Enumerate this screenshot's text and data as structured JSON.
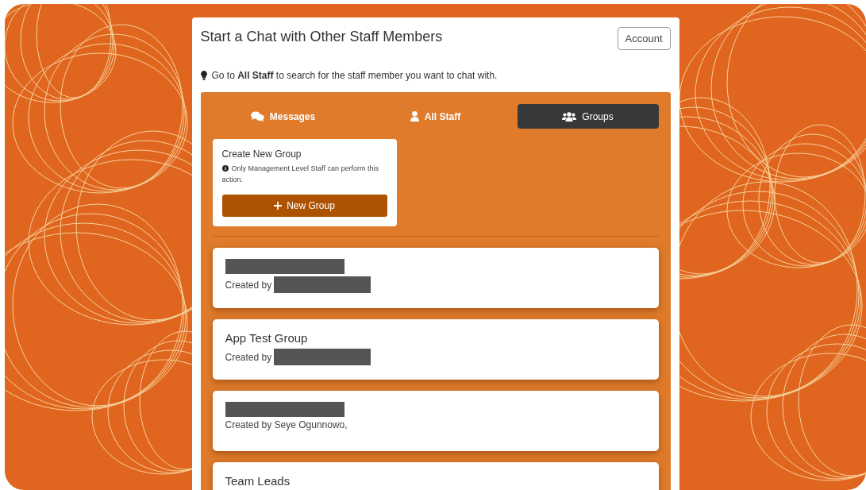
{
  "header": {
    "title": "Start a Chat with Other Staff Members",
    "account_button": "Account"
  },
  "hint": {
    "text": "Go to **All Staff** to search for the staff member you want to chat with."
  },
  "tabs": [
    {
      "label": "Messages",
      "selected": false
    },
    {
      "label": "All Staff",
      "selected": false
    },
    {
      "label": "Groups",
      "selected": true
    }
  ],
  "create_group": {
    "title": "Create New Group",
    "notice": "Only Management Level Staff can perform this action.",
    "button": "New Group"
  },
  "groups": [
    {
      "title_redacted": true,
      "created_by_label": "Created by",
      "creator_redacted": true
    },
    {
      "title": "App Test Group",
      "title_redacted": false,
      "created_by_label": "Created by",
      "creator_redacted": true
    },
    {
      "title_redacted": true,
      "created_by_label": "Created by Seye Ogunnowo,",
      "creator_redacted": false
    },
    {
      "title": "Team Leads",
      "title_redacted": false
    }
  ]
}
